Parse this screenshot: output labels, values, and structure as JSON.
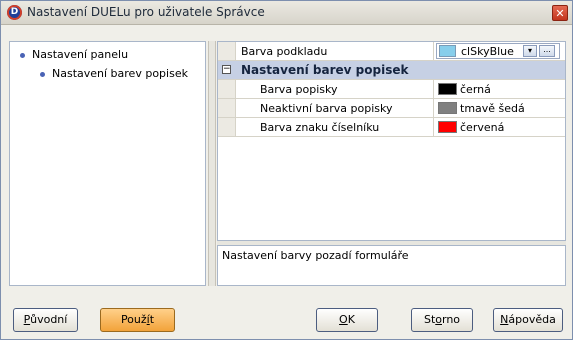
{
  "window": {
    "title": "Nastavení DUELu pro uživatele Správce",
    "app_icon_letter": "D",
    "close_glyph": "✕"
  },
  "tree": {
    "items": [
      {
        "label": "Nastavení panelu"
      },
      {
        "label": "Nastavení barev popisek"
      }
    ]
  },
  "grid": {
    "background_row": {
      "label": "Barva podkladu",
      "value": "clSkyBlue",
      "swatch_color": "#87ceeb",
      "arrow": "▾",
      "ellipsis": "..."
    },
    "category": {
      "toggle": "−",
      "label": "Nastavení barev popisek"
    },
    "rows": [
      {
        "label": "Barva popisky",
        "value": "černá",
        "swatch_color": "#000000"
      },
      {
        "label": "Neaktivní barva popisky",
        "value": "tmavě šedá",
        "swatch_color": "#808080"
      },
      {
        "label": "Barva znaku číselníku",
        "value": "červená",
        "swatch_color": "#ff0000"
      }
    ]
  },
  "description": {
    "text": "Nastavení barvy pozadí formuláře"
  },
  "buttons": {
    "original": {
      "first": "P",
      "rest": "ůvodní"
    },
    "apply": {
      "first": "Použ",
      "accel": "í",
      "rest": "t"
    },
    "ok": {
      "first": "O",
      "rest": "K"
    },
    "cancel": {
      "first": "St",
      "accel": "o",
      "rest": "rno"
    },
    "help": {
      "first": "N",
      "rest": "ápověda"
    }
  },
  "colors": {
    "title_gradient_top": "#ebe9e2",
    "category_bg": "#c6d0e4",
    "apply_button": "#f2a33a",
    "close_button": "#c2341d"
  }
}
